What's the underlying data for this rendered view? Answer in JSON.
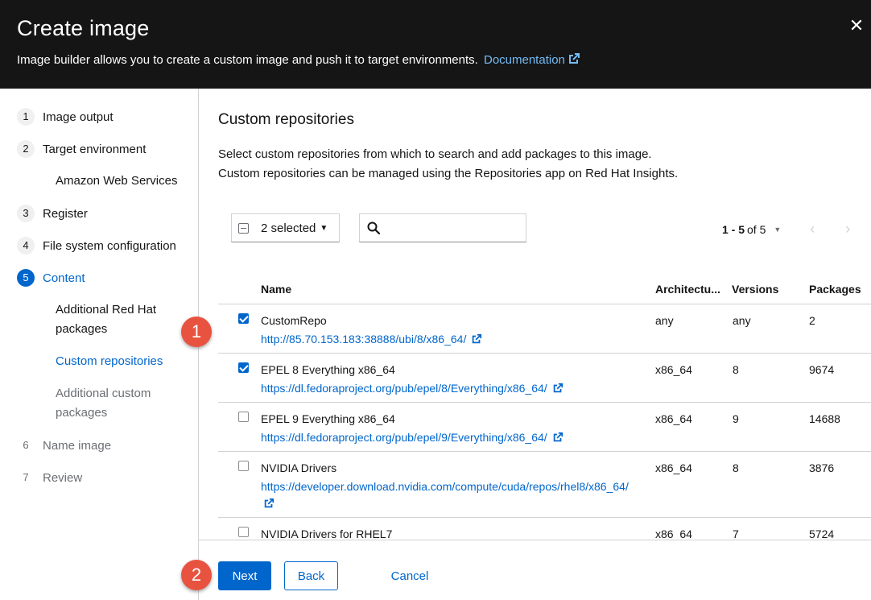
{
  "header": {
    "title": "Create image",
    "description": "Image builder allows you to create a custom image and push it to target environments.",
    "doc_link": "Documentation"
  },
  "nav": {
    "steps": [
      {
        "num": "1",
        "label": "Image output"
      },
      {
        "num": "2",
        "label": "Target environment"
      },
      {
        "num": "3",
        "label": "Register"
      },
      {
        "num": "4",
        "label": "File system configuration"
      },
      {
        "num": "5",
        "label": "Content"
      },
      {
        "num": "6",
        "label": "Name image"
      },
      {
        "num": "7",
        "label": "Review"
      }
    ],
    "sub": {
      "aws": "Amazon Web Services",
      "additional_rh": "Additional Red Hat packages",
      "custom_repos": "Custom repositories",
      "additional_custom": "Additional custom packages"
    }
  },
  "main": {
    "heading": "Custom repositories",
    "intro_line1": "Select custom repositories from which to search and add packages to this image.",
    "intro_line2": "Custom repositories can be managed using the Repositories app on Red Hat Insights."
  },
  "toolbar": {
    "selected": "2 selected",
    "search_placeholder": "",
    "range": "1 - 5",
    "of_total": "of 5"
  },
  "table": {
    "columns": [
      "Name",
      "Architectu...",
      "Versions",
      "Packages"
    ],
    "rows": [
      {
        "name": "CustomRepo",
        "url": "http://85.70.153.183:38888/ubi/8/x86_64/",
        "arch": "any",
        "versions": "any",
        "packages": "2",
        "checked": true
      },
      {
        "name": "EPEL 8 Everything x86_64",
        "url": "https://dl.fedoraproject.org/pub/epel/8/Everything/x86_64/",
        "arch": "x86_64",
        "versions": "8",
        "packages": "9674",
        "checked": true
      },
      {
        "name": "EPEL 9 Everything x86_64",
        "url": "https://dl.fedoraproject.org/pub/epel/9/Everything/x86_64/",
        "arch": "x86_64",
        "versions": "9",
        "packages": "14688",
        "checked": false
      },
      {
        "name": "NVIDIA Drivers",
        "url": "https://developer.download.nvidia.com/compute/cuda/repos/rhel8/x86_64/",
        "arch": "x86_64",
        "versions": "8",
        "packages": "3876",
        "checked": false
      },
      {
        "name": "NVIDIA Drivers for RHEL7",
        "url": "",
        "arch": "x86_64",
        "versions": "7",
        "packages": "5724",
        "checked": false
      }
    ]
  },
  "footer": {
    "next": "Next",
    "back": "Back",
    "cancel": "Cancel"
  },
  "callouts": [
    "1",
    "2"
  ],
  "colors": {
    "header_bg": "#151515",
    "primary": "#0066cc",
    "link_dark": "#73bcf7",
    "callout": "#e8533f"
  }
}
